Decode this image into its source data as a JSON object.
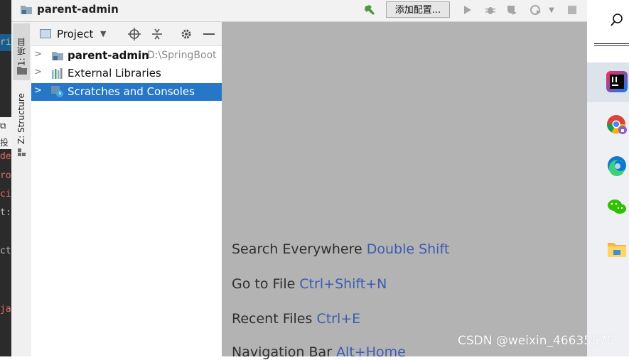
{
  "window": {
    "title": "parent-admin",
    "run_config_label": "添加配置..."
  },
  "toolstrip": {
    "project_tab": "1: 项目",
    "structure_tab": "Z: Structure"
  },
  "panel": {
    "view_label": "Project",
    "tree": [
      {
        "label": "parent-admin",
        "path": "D:\\SpringBoot",
        "bold": true
      },
      {
        "label": "External Libraries"
      },
      {
        "label": "Scratches and Consoles",
        "selected": true
      }
    ]
  },
  "editor": {
    "hints": [
      {
        "text": "Search Everywhere",
        "key": "Double Shift"
      },
      {
        "text": "Go to File",
        "key": "Ctrl+Shift+N"
      },
      {
        "text": "Recent Files",
        "key": "Ctrl+E"
      },
      {
        "text": "Navigation Bar",
        "key": "Alt+Home"
      }
    ]
  },
  "left_sliver": {
    "frags": [
      "rin",
      "de.",
      "rou",
      "cit",
      "t:/v",
      "ct",
      "jav",
      "投"
    ]
  },
  "watermark": "CSDN @weixin_46635575",
  "colors": {
    "selection": "#2677c8",
    "shortcut_blue": "#3b5cb0",
    "editor_bg": "#b3b3b3"
  },
  "icons": [
    "folder-icon",
    "hammer-icon",
    "run-icon",
    "debug-icon",
    "coverage-icon",
    "profile-icon",
    "stop-icon",
    "crosshair-icon",
    "collapse-icon",
    "gear-icon",
    "minimize-icon",
    "search-icon"
  ]
}
